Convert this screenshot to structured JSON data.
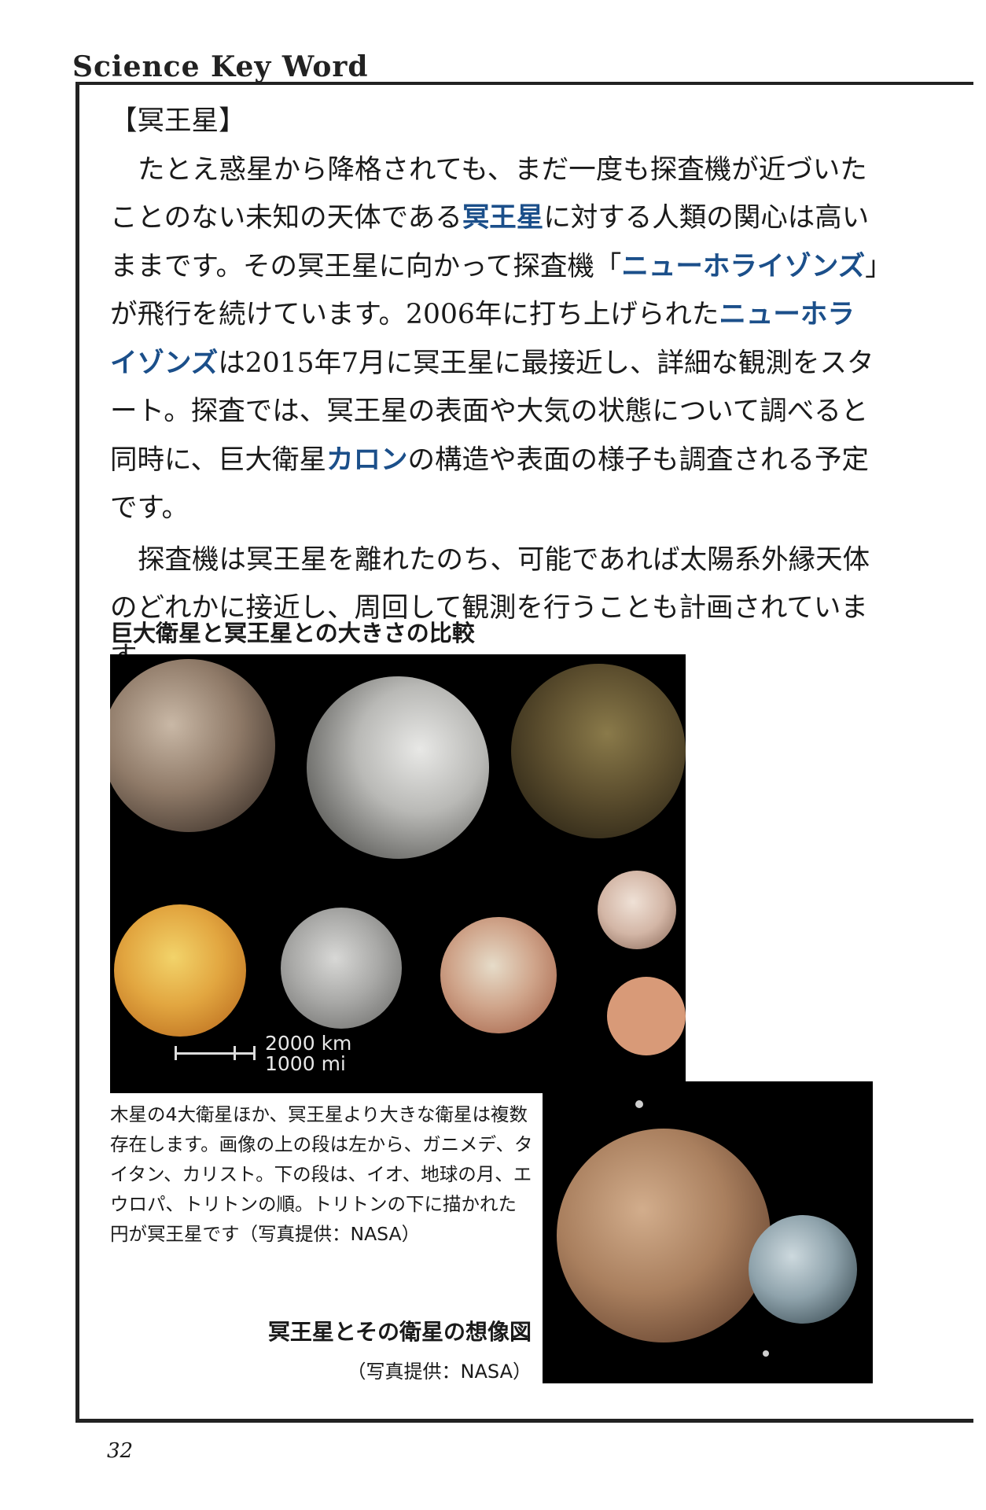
{
  "header": {
    "title": "Science Key Word"
  },
  "article": {
    "heading": "【冥王星】",
    "p1": [
      "たとえ惑星から降格されても、まだ一度も探査機が近づいたことのない未知の天体である",
      "冥王星",
      "に対する人類の関心は高いままです。その冥王星に向かって探査機「",
      "ニューホライゾンズ",
      "」が飛行を続けています。2006年に打ち上げられた",
      "ニューホライゾンズ",
      "は2015年7月に冥王星に最接近し、詳細な観測をスタート。探査では、冥王星の表面や大気の状態について調べると同時に、巨大衛星",
      "カロン",
      "の構造や表面の様子も調査される予定です。"
    ],
    "p2": "探査機は冥王星を離れたのち、可能であれば太陽系外縁天体のどれかに接近し、周回して観測を行うことも計画されています。"
  },
  "figure1": {
    "title": "巨大衛星と冥王星との大きさの比較",
    "scale_km": "2000 km",
    "scale_mi": "1000 mi",
    "caption": "木星の4大衛星ほか、冥王星より大きな衛星は複数存在します。画像の上の段は左から、ガニメデ、タイタン、カリスト。下の段は、イオ、地球の月、エウロパ、トリトンの順。トリトンの下に描かれた円が冥王星です（写真提供：NASA）"
  },
  "figure2": {
    "title": "冥王星とその衛星の想像図",
    "credit": "（写真提供：NASA）"
  },
  "page_number": "32",
  "colors": {
    "keyword": "#1b4f8a",
    "pluto_disc": "#d89a78",
    "frame": "#222222"
  }
}
